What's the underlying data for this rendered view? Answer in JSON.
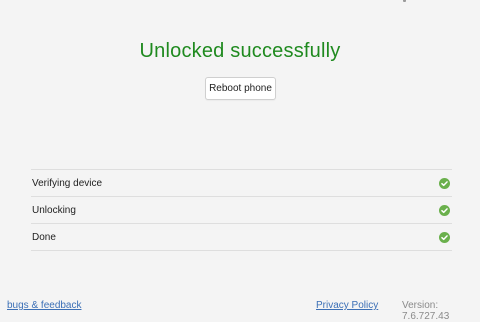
{
  "status": {
    "title": "Unlocked successfully",
    "color": "#1f8a1f"
  },
  "actions": {
    "reboot_label": "Reboot phone"
  },
  "steps": [
    {
      "label": "Verifying device",
      "state": "done",
      "icon": "check-circle-icon"
    },
    {
      "label": "Unlocking",
      "state": "done",
      "icon": "check-circle-icon"
    },
    {
      "label": "Done",
      "state": "done",
      "icon": "check-circle-icon"
    }
  ],
  "footer": {
    "bugs_label": "bugs & feedback",
    "privacy_label": "Privacy Policy",
    "version_text": "Version: 7.6.727.43"
  },
  "colors": {
    "background": "#f4f4f4",
    "success": "#1f8a1f",
    "check": "#6ab04c",
    "link": "#3b6fb6"
  }
}
